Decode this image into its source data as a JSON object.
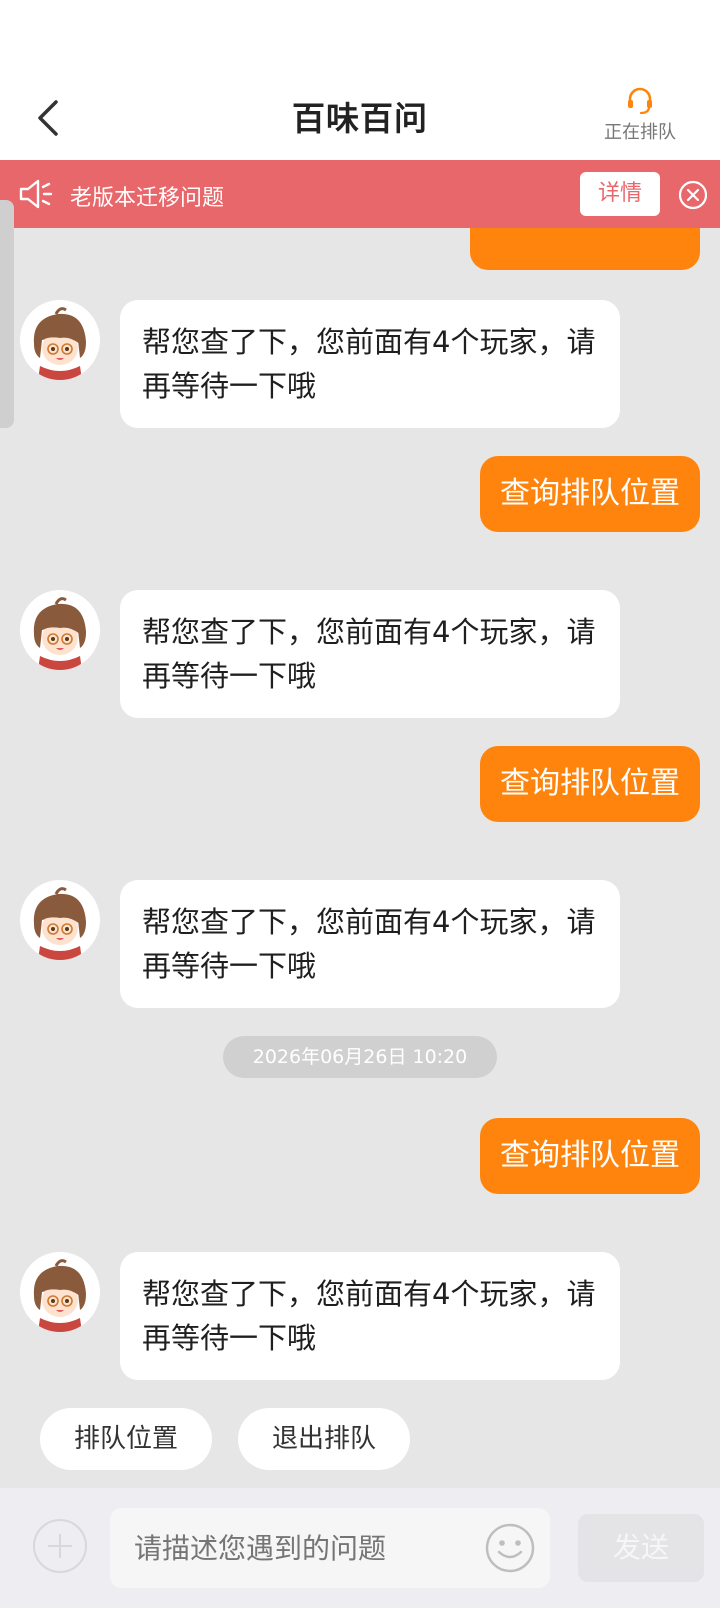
{
  "header": {
    "title": "百味百问",
    "queue_label": "正在排队"
  },
  "notice": {
    "text": "老版本迁移问题",
    "detail_label": "详情"
  },
  "messages": {
    "agent_reply": "帮您查了下，您前面有4个玩家，请再等待一下哦",
    "user_query": "查询排队位置",
    "timestamp": "2026年06月26日 10:20"
  },
  "quick_replies": {
    "queue_position": "排队位置",
    "exit_queue": "退出排队"
  },
  "input": {
    "placeholder": "请描述您遇到的问题",
    "send_label": "发送"
  },
  "colors": {
    "accent_orange": "#ff840d",
    "notice_red": "#e8676b",
    "chat_bg": "#e6e6e6"
  }
}
